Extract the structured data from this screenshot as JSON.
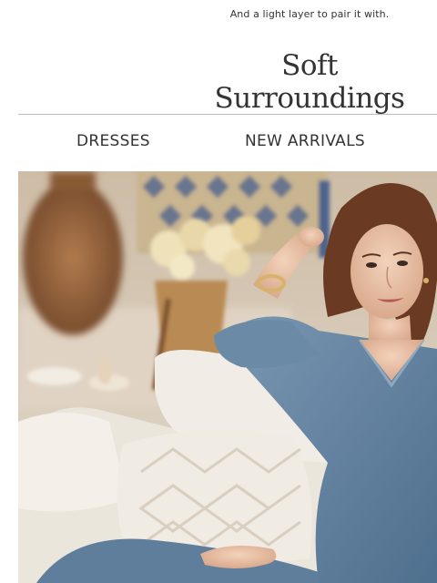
{
  "preheader": {
    "text": "And a light layer to pair it with."
  },
  "brand": {
    "logo_text": "Soft Surroundings"
  },
  "nav": {
    "items": [
      {
        "label": "DRESSES"
      },
      {
        "label": "NEW ARRIVALS"
      }
    ]
  },
  "colors": {
    "text": "#333333",
    "rule": "#bdbdbd",
    "denim": "#5f7f9c",
    "hair": "#6b3a22",
    "sofa": "#e9e4da"
  },
  "icons": []
}
